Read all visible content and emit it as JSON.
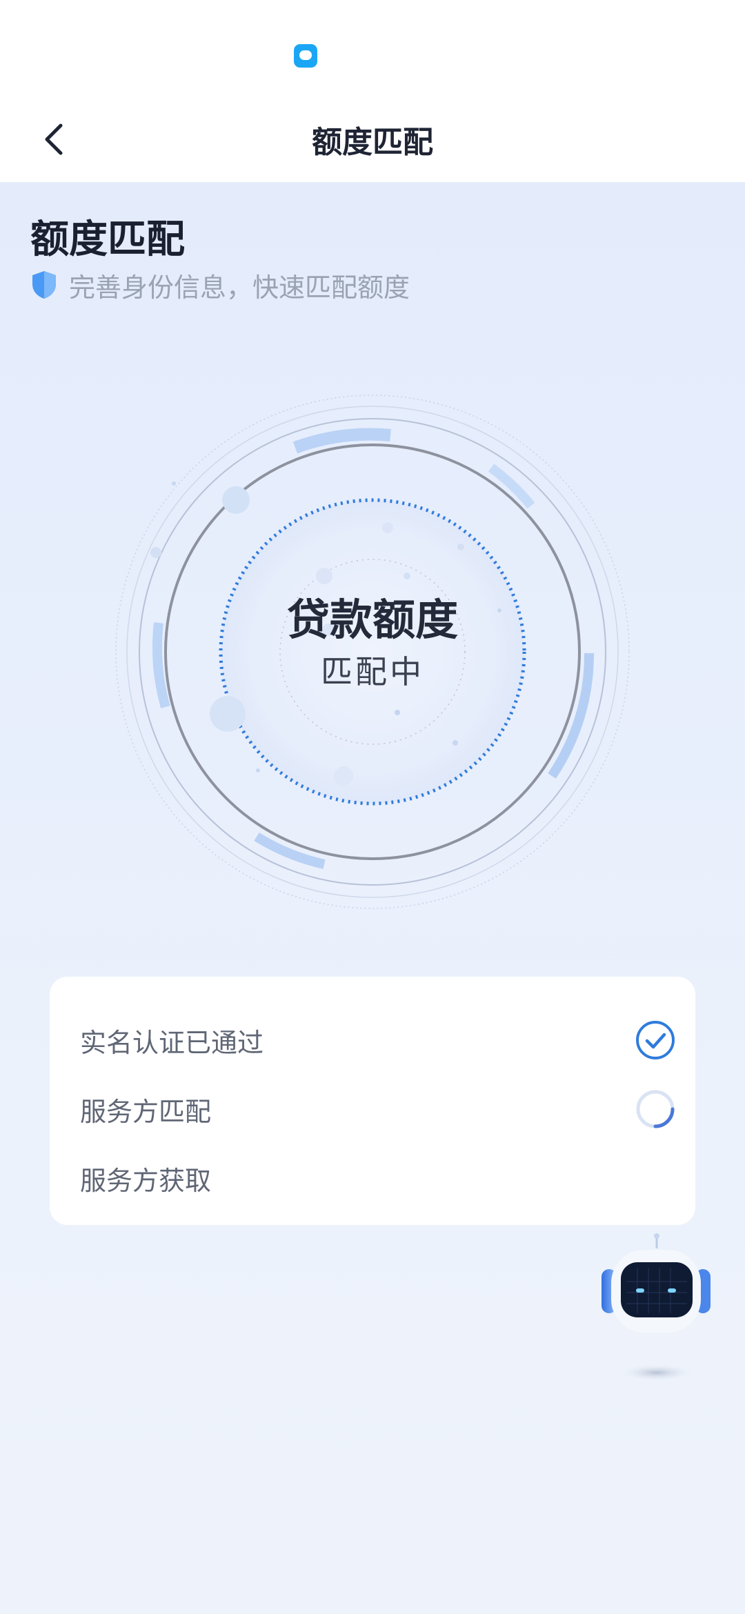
{
  "navbar": {
    "title": "额度匹配"
  },
  "header": {
    "title": "额度匹配",
    "subtitle": "完善身份信息，快速匹配额度"
  },
  "radar": {
    "title": "贷款额度",
    "status": "匹配中"
  },
  "steps": [
    {
      "label": "实名认证已通过",
      "state": "done"
    },
    {
      "label": "服务方匹配",
      "state": "loading"
    },
    {
      "label": "服务方获取",
      "state": "pending"
    }
  ],
  "icons": {
    "status": "chat-bubble-icon",
    "back": "chevron-left-icon",
    "shield": "shield-icon",
    "check": "check-circle-icon",
    "loading": "loading-spinner-icon",
    "assistant": "robot-assistant-icon"
  },
  "colors": {
    "accent": "#2f7bdc",
    "shield": "#4a9af5",
    "status_icon": "#1ba6f5",
    "card": "#ffffff",
    "text_muted": "#9aa3b3"
  }
}
